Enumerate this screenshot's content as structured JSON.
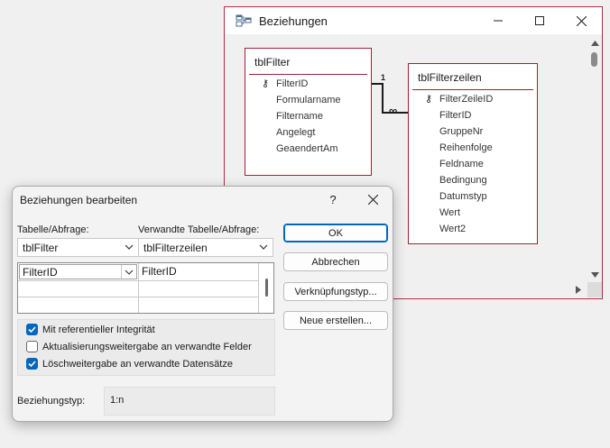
{
  "relationships_window": {
    "title": "Beziehungen",
    "table_left": {
      "name": "tblFilter",
      "fields": [
        "FilterID",
        "Formularname",
        "Filtername",
        "Angelegt",
        "GeaendertAm"
      ],
      "key_field": "FilterID"
    },
    "table_right": {
      "name": "tblFilterzeilen",
      "fields": [
        "FilterZeileID",
        "FilterID",
        "GruppeNr",
        "Reihenfolge",
        "Feldname",
        "Bedingung",
        "Datumstyp",
        "Wert",
        "Wert2"
      ],
      "key_field": "FilterZeileID"
    },
    "join": {
      "one": "1",
      "many": "∞"
    }
  },
  "dialog": {
    "title": "Beziehungen bearbeiten",
    "help": "?",
    "table_label": "Tabelle/Abfrage:",
    "related_label": "Verwandte Tabelle/Abfrage:",
    "table_value": "tblFilter",
    "related_value": "tblFilterzeilen",
    "grid_rows": [
      {
        "left": "FilterID",
        "right": "FilterID"
      },
      {
        "left": "",
        "right": ""
      },
      {
        "left": "",
        "right": ""
      }
    ],
    "buttons": {
      "ok": "OK",
      "cancel": "Abbrechen",
      "join_type": "Verknüpfungstyp...",
      "create_new": "Neue erstellen..."
    },
    "checkboxes": [
      {
        "label": "Mit referentieller Integrität",
        "checked": true
      },
      {
        "label": "Aktualisierungsweitergabe an verwandte Felder",
        "checked": false
      },
      {
        "label": "Löschweitergabe an verwandte Datensätze",
        "checked": true
      }
    ],
    "relationship_type_label": "Beziehungstyp:",
    "relationship_type_value": "1:n"
  },
  "colors": {
    "accent": "#0067c0",
    "table_border": "#a31f34"
  }
}
